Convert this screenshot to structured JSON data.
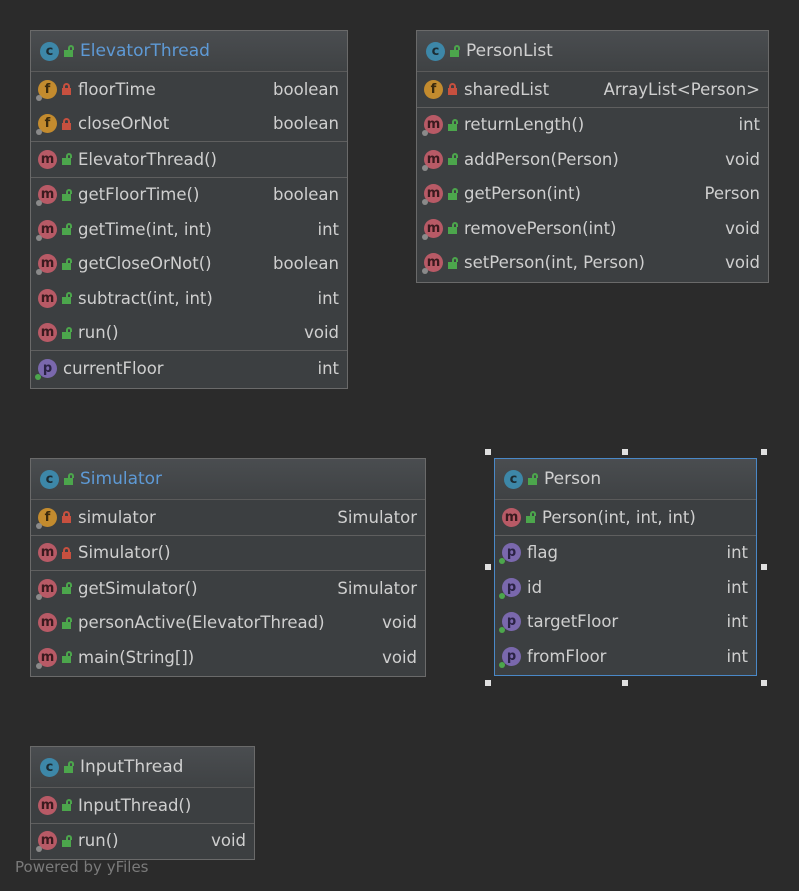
{
  "classes": {
    "elevator_thread": {
      "name": "ElevatorThread",
      "fields": [
        {
          "name": "floorTime",
          "type": "boolean"
        },
        {
          "name": "closeOrNot",
          "type": "boolean"
        }
      ],
      "constructors": [
        {
          "name": "ElevatorThread()",
          "type": ""
        }
      ],
      "methods": [
        {
          "name": "getFloorTime()",
          "type": "boolean"
        },
        {
          "name": "getTime(int, int)",
          "type": "int"
        },
        {
          "name": "getCloseOrNot()",
          "type": "boolean"
        },
        {
          "name": "subtract(int, int)",
          "type": "int"
        },
        {
          "name": "run()",
          "type": "void"
        }
      ],
      "properties": [
        {
          "name": "currentFloor",
          "type": "int"
        }
      ]
    },
    "person_list": {
      "name": "PersonList",
      "fields": [
        {
          "name": "sharedList",
          "type": "ArrayList<Person>"
        }
      ],
      "methods": [
        {
          "name": "returnLength()",
          "type": "int"
        },
        {
          "name": "addPerson(Person)",
          "type": "void"
        },
        {
          "name": "getPerson(int)",
          "type": "Person"
        },
        {
          "name": "removePerson(int)",
          "type": "void"
        },
        {
          "name": "setPerson(int, Person)",
          "type": "void"
        }
      ]
    },
    "simulator": {
      "name": "Simulator",
      "fields": [
        {
          "name": "simulator",
          "type": "Simulator"
        }
      ],
      "constructors": [
        {
          "name": "Simulator()",
          "type": ""
        }
      ],
      "methods": [
        {
          "name": "getSimulator()",
          "type": "Simulator"
        },
        {
          "name": "personActive(ElevatorThread)",
          "type": "void"
        },
        {
          "name": "main(String[])",
          "type": "void"
        }
      ]
    },
    "person": {
      "name": "Person",
      "constructors": [
        {
          "name": "Person(int, int, int)",
          "type": ""
        }
      ],
      "properties": [
        {
          "name": "flag",
          "type": "int"
        },
        {
          "name": "id",
          "type": "int"
        },
        {
          "name": "targetFloor",
          "type": "int"
        },
        {
          "name": "fromFloor",
          "type": "int"
        }
      ]
    },
    "input_thread": {
      "name": "InputThread",
      "constructors": [
        {
          "name": "InputThread()",
          "type": ""
        }
      ],
      "methods": [
        {
          "name": "run()",
          "type": "void"
        }
      ]
    }
  },
  "icons": {
    "class": "c",
    "method": "m",
    "field": "f",
    "property": "p"
  },
  "colors": {
    "background": "#2b2b2b",
    "node": "#3c3f41",
    "class_icon": "#3d87a8",
    "method_icon": "#b85a66",
    "field_icon": "#c38b2e",
    "property_icon": "#7a68ad",
    "public": "#4ca64c",
    "private": "#c7503f",
    "selection": "#4a88c7"
  },
  "footer": {
    "credit": "Powered by yFiles"
  }
}
